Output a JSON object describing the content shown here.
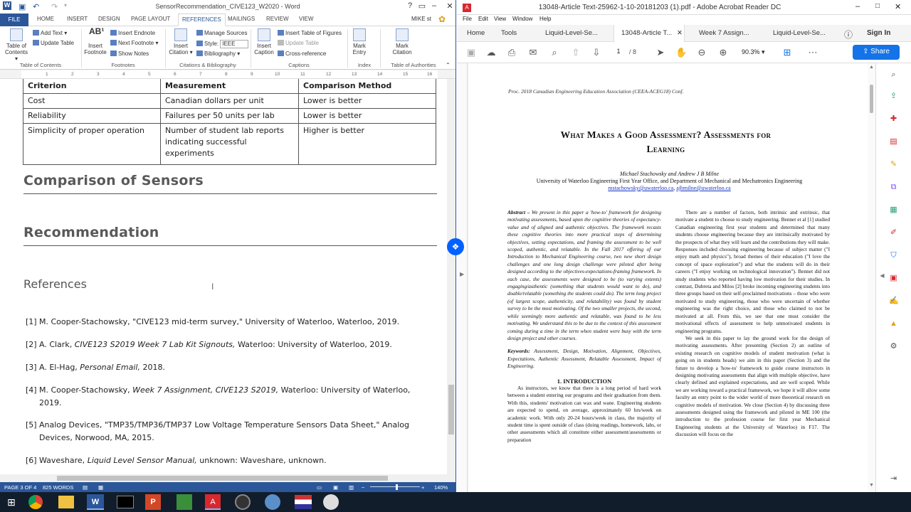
{
  "word": {
    "window_title": "SensorRecommendation_CIVE123_W2020 - Word",
    "user": "MIKE st",
    "tabs": [
      "FILE",
      "HOME",
      "INSERT",
      "DESIGN",
      "PAGE LAYOUT",
      "REFERENCES",
      "MAILINGS",
      "REVIEW",
      "VIEW"
    ],
    "active_tab": "REFERENCES",
    "ribbon": {
      "toc": "Table of Contents",
      "add_text": "Add Text",
      "update_table": "Update Table",
      "insert_footnote": "Insert Footnote",
      "insert_endnote": "Insert Endnote",
      "next_footnote": "Next Footnote",
      "show_notes": "Show Notes",
      "insert_citation": "Insert Citation",
      "manage_sources": "Manage Sources",
      "style_label": "Style:",
      "style_value": "IEEE",
      "bibliography": "Bibliography",
      "insert_caption": "Insert Caption",
      "insert_table_figures": "Insert Table of Figures",
      "update_table_caption": "Update Table",
      "cross_reference": "Cross-reference",
      "mark_entry": "Mark Entry",
      "mark_citation": "Mark Citation",
      "groups": [
        "Table of Contents",
        "Footnotes",
        "Citations & Bibliography",
        "Captions",
        "Index",
        "Table of Authorities"
      ]
    },
    "ruler": [
      "1",
      "2",
      "3",
      "4",
      "5",
      "6",
      "7",
      "8",
      "9",
      "10",
      "11",
      "12",
      "13",
      "14",
      "15",
      "16"
    ],
    "table": {
      "headers": [
        "Criterion",
        "Measurement",
        "Comparison Method"
      ],
      "rows": [
        [
          "Cost",
          "Canadian dollars per unit",
          "Lower is better"
        ],
        [
          "Reliability",
          "Failures per 50 units per lab",
          "Lower is better"
        ],
        [
          "Simplicity of proper operation",
          "Number of student lab reports indicating successful experiments",
          "Higher is better"
        ]
      ]
    },
    "headings": {
      "comparison": "Comparison of Sensors",
      "recommendation": "Recommendation",
      "references": "References"
    },
    "references": [
      {
        "num": "[1]",
        "text": "M. Cooper-Stachowsky, \"CIVE123 mid-term survey,\" University of Waterloo, Waterloo, 2019."
      },
      {
        "num": "[2]",
        "pre": "A. Clark, ",
        "ital": "CIVE123 S2019 Week 7 Lab Kit Signouts,",
        "post": " Waterloo: University of Waterloo, 2019."
      },
      {
        "num": "[3]",
        "pre": "A. El-Hag, ",
        "ital": "Personal Email,",
        "post": " 2018."
      },
      {
        "num": "[4]",
        "pre": "M. Cooper-Stachowsky, ",
        "ital": "Week 7 Assignment, CIVE123 S2019,",
        "post": " Waterloo: University of Waterloo, 2019."
      },
      {
        "num": "[5]",
        "text": "Analog Devices, \"TMP35/TMP36/TMP37 Low Voltage Temperature Sensors Data Sheet,\" Analog Devices, Norwood, MA, 2015."
      },
      {
        "num": "[6]",
        "pre": "Waveshare, ",
        "ital": "Liquid Level Sensor Manual,",
        "post": " unknown: Waveshare, unknown."
      }
    ],
    "status": {
      "page": "PAGE 3 OF 4",
      "words": "825 WORDS",
      "zoom": "140%"
    }
  },
  "acrobat": {
    "window_title": "13048-Article Text-25962-1-10-20181203 (1).pdf - Adobe Acrobat Reader DC",
    "menu": [
      "File",
      "Edit",
      "View",
      "Window",
      "Help"
    ],
    "tabs": [
      "Home",
      "Tools",
      "Liquid-Level-Se...",
      "13048-Article T...",
      "Week 7 Assign...",
      "Liquid-Level-Se..."
    ],
    "sign_in": "Sign In",
    "page_current": "1",
    "page_total": "/ 8",
    "zoom": "90.3%",
    "share": "Share",
    "paper": {
      "header": "Proc. 2018 Canadian Engineering Education Association (CEEA-ACEG18) Conf.",
      "title_line1": "What Makes a Good Assessment? Assessments for",
      "title_line2": "Learning",
      "authors": "Michael Stachowsky and Andrew J B Milne",
      "affiliation": "University of Waterloo Engineering First Year Office, and Department of Mechanical and Mechatronics Engineering",
      "email1": "mstachowsky@uwaterloo.ca",
      "email2": "ajbmilne@uwaterloo.ca",
      "abstract_label": "Abstract –",
      "abstract": "We present in this paper a 'how-to' framework for designing motivating assessments, based upon the cognitive theories of expectancy-value and of aligned and authentic objectives. The framework recasts these cognitive theories into more practical steps of determining objectives, setting expectations, and framing the assessment to be well scoped, authentic, and relatable. In the Fall 2017 offering of our Introduction to Mechanical Engineering course, two new short design challenges and one long design challenge were piloted after being designed according to the objectives-expectations-framing framework. In each case, the assessments were designed to be (to varying extents) engaging/authentic (something that students would want to do), and doable/relatable (something the students could do). The term long project (of largest scope, authenticity, and relatability) was found by student survey to be the most motivating. Of the two smaller projects, the second, while seemingly more authentic and relatable, was found to be less motivating. We understand this to be due to the context of this assessment coming during a time in the term when student were busy with the term design project and other courses.",
      "keywords_label": "Keywords:",
      "keywords": "Assessment, Design, Motivation, Alignment, Objectives, Expectations, Authentic Assessment, Relatable Assessment, Impact of Engineering.",
      "intro_heading": "1. INTRODUCTION",
      "intro": "As instructors, we know that there is a long period of hard work between a student entering our programs and their graduation from them. With this, students' motivation can wax and wane. Engineering students are expected to spend, on average, approximately 60 hrs/week on academic work. With only 20-24 hours/week in class, the majority of student time is spent outside of class (doing readings, homework, labs, or other assessments which all constitute either assessment/assessments or preparation",
      "col2_p1": "There are a number of factors, both intrinsic and extrinsic, that motivate a student to choose to study engineering. Bennet et al [1] studied Canadian engineering first year students and determined that many students choose engineering because they are intrinsically motivated by the prospects of what they will learn and the contributions they will make. Responses included choosing engineering because of subject matter (\"I enjoy math and physics\"), broad themes of their education (\"I love the concept of space exploration\") and what the students will do in their careers (\"I enjoy working on technological innovation\"). Bennet did not study students who reported having low motivation for their studies. In contrast, Dubreta and Milos [2] broke incoming engineering students into three groups based on their self-proclaimed motivations – those who were motivated to study engineering, those who were uncertain of whether engineering was the right choice, and those who claimed to not be motivated at all. From this, we see that one must consider the motivational effects of assessment to help unmotivated students in engineering programs.",
      "col2_p2": "We seek in this paper to lay the ground work for the design of motivating assessments. After presenting (Section 2) an outline of existing research on cognitive models of student motivation (what is going on in students heads) we aim in this paper (Section 3) and the future to develop a 'how-to' framework to guide course instructors in designing motivating assessments that align with multiple objective, have clearly defined and explained expectations, and are well scoped. While we are working toward a practical framework, we hope it will allow some faculty an entry point to the wider world of more theoretical research on cognitive models of motivation. We close (Section 4) by discussing three assessments designed using the framework and piloted in ME 100 (the introduction to the profession course for first year Mechanical Engineering students at the University of Waterloo) in F17. The discussion will focus on the"
    }
  }
}
